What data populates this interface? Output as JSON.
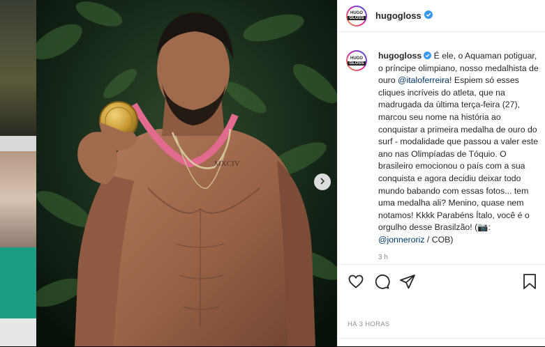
{
  "post": {
    "username": "hugogloss",
    "avatar_text_top": "HUGO",
    "avatar_text_bottom": "GLOSS",
    "caption": {
      "username": "hugogloss",
      "part1": " É ele, o Aquaman potiguar, o príncipe olimpiano, nosso medalhista de ouro ",
      "mention1": "@italoferreira",
      "part2": "! Espiem só esses cliques incríveis do atleta, que na madrugada da última terça-feira (27), marcou seu nome na história ao conquistar a primeira medalha de ouro do surf - modalidade que passou a valer este ano nas Olimpíadas de Tóquio. O brasileiro emocionou o país com a sua conquista e agora decidiu deixar todo mundo babando com essas fotos... tem uma medalha ali? Menino, quase nem notamos! Kkkk Parabéns Ítalo, você é o orgulho desse Brasilzão! (📷: ",
      "mention2": "@jonneroriz",
      "part3": " / COB)"
    },
    "caption_time": "3 h",
    "timestamp": "HÁ 3 HORAS",
    "photo_tattoo": "MXCIV"
  },
  "icons": {
    "like": "heart-icon",
    "comment": "comment-icon",
    "share": "share-icon",
    "save": "bookmark-icon",
    "next": "chevron-right-icon",
    "verified": "verified-badge-icon"
  },
  "colors": {
    "verified": "#3897f0",
    "mention": "#00376b",
    "muted": "#8e8e8e"
  }
}
